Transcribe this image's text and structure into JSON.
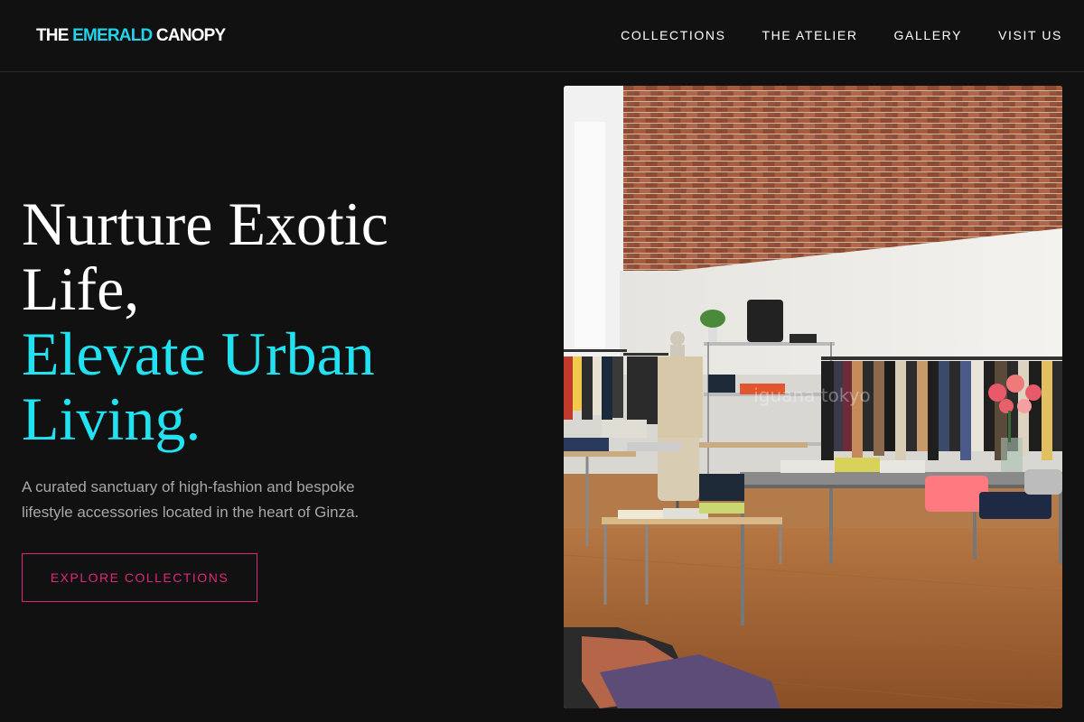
{
  "brand": {
    "name_part1": "THE ",
    "name_accent": "EMERALD",
    "name_part2": " CANOPY"
  },
  "nav": {
    "items": [
      {
        "label": "COLLECTIONS"
      },
      {
        "label": "THE ATELIER"
      },
      {
        "label": "GALLERY"
      },
      {
        "label": "VISIT US"
      }
    ]
  },
  "hero": {
    "title_line1": "Nurture Exotic",
    "title_line2": "Life,",
    "title_line3": "Elevate Urban",
    "title_line4": "Living.",
    "subtitle": "A curated sanctuary of high-fashion and bespoke lifestyle accessories located in the heart of Ginza.",
    "cta_label": "EXPLORE COLLECTIONS",
    "image_watermark": "iguana tokyo"
  },
  "colors": {
    "background": "#111111",
    "accent_cyan": "#22e1f0",
    "accent_pink": "#e0267a"
  }
}
